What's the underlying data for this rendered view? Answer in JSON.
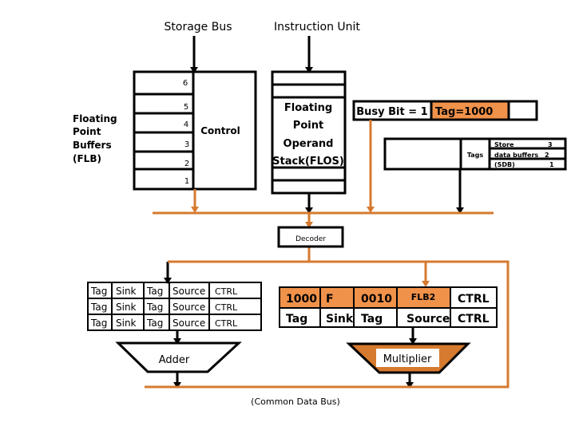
{
  "labels": {
    "storage_bus": "Storage Bus",
    "instruction_unit": "Instruction Unit",
    "flb": [
      "Floating",
      "Point",
      "Buffers",
      "(FLB)"
    ],
    "flb_rows": [
      "6",
      "5",
      "4",
      "3",
      "2",
      "1"
    ],
    "control": "Control",
    "flos": [
      "Floating",
      "Point",
      "Operand",
      "Stack(FLOS)"
    ],
    "busy_bit": "Busy Bit = 1",
    "tag_value": "Tag=1000",
    "tags": "Tags",
    "sdb": [
      {
        "name": "Store",
        "num": "3"
      },
      {
        "name": "data buffers",
        "num": "2"
      },
      {
        "name": "(SDB)",
        "num": "1"
      }
    ],
    "decoder": "Decoder",
    "adder_table": [
      [
        "Tag",
        "Sink",
        "Tag",
        "Source",
        "CTRL"
      ],
      [
        "Tag",
        "Sink",
        "Tag",
        "Source",
        "CTRL"
      ],
      [
        "Tag",
        "Sink",
        "Tag",
        "Source",
        "CTRL"
      ]
    ],
    "mult_table": [
      [
        "1000",
        "F",
        "0010",
        "FLB2",
        "CTRL"
      ],
      [
        "Tag",
        "Sink",
        "Tag",
        "Source",
        "CTRL"
      ]
    ],
    "adder": "Adder",
    "multiplier": "Multiplier",
    "cdb": "(Common Data Bus)"
  },
  "colors": {
    "accent": "#f0924a",
    "bus": "#d67a2f",
    "line": "#000000"
  }
}
